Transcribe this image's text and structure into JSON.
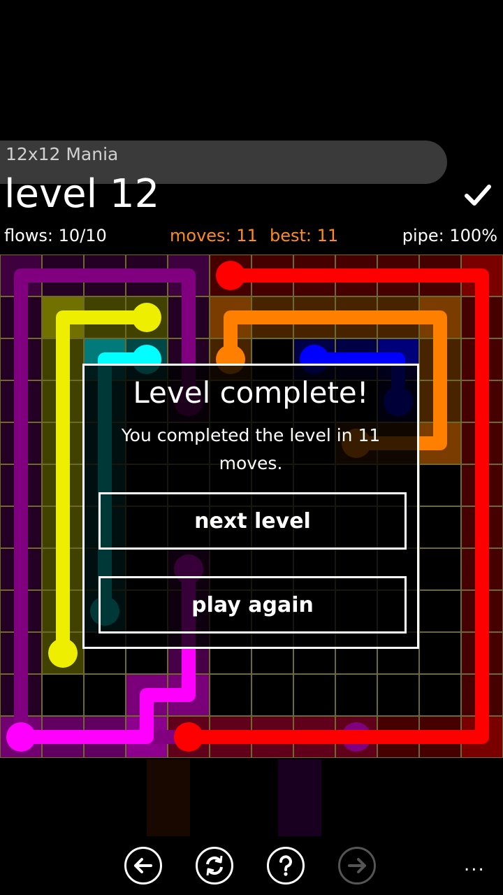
{
  "header": {
    "pack_name": "12x12 Mania",
    "level_title": "level 12",
    "check_icon": "checkmark-icon"
  },
  "stats": {
    "flows": "flows: 10/10",
    "moves": "moves: 11",
    "best": "best: 11",
    "pipe": "pipe: 100%"
  },
  "colors": {
    "background": "#000000",
    "board_line": "#6e6a2a",
    "accent_orange": "#ff8c1a",
    "red": "#ff0000",
    "orange": "#ff7f00",
    "yellow": "#eeee00",
    "cyan": "#00ffff",
    "blue": "#0000ff",
    "purple": "#800080",
    "magenta": "#ff00ff",
    "green": "#008000",
    "gray": "#a0a0a0",
    "maroon": "#a52a2a"
  },
  "board": {
    "size": 12,
    "flows": [
      {
        "color": "#800080",
        "path": [
          [
            8,
            11
          ],
          [
            0,
            11
          ],
          [
            0,
            0
          ],
          [
            4,
            0
          ],
          [
            4,
            3
          ]
        ]
      },
      {
        "color": "#eeee00",
        "path": [
          [
            3,
            1
          ],
          [
            1,
            1
          ],
          [
            1,
            9
          ]
        ]
      },
      {
        "color": "#ff00ff",
        "path": [
          [
            0,
            11
          ],
          [
            3,
            11
          ],
          [
            3,
            10
          ],
          [
            4,
            10
          ],
          [
            4,
            7
          ]
        ]
      },
      {
        "color": "#ff0000",
        "path": [
          [
            5,
            0
          ],
          [
            11,
            0
          ],
          [
            11,
            11
          ],
          [
            4,
            11
          ]
        ]
      },
      {
        "color": "#ff7f00",
        "path": [
          [
            5,
            2
          ],
          [
            5,
            1
          ],
          [
            10,
            1
          ],
          [
            10,
            4
          ],
          [
            8,
            4
          ]
        ]
      },
      {
        "color": "#0000ff",
        "path": [
          [
            7,
            2
          ],
          [
            9,
            2
          ],
          [
            9,
            3
          ]
        ]
      },
      {
        "color": "#00ffff",
        "path": [
          [
            3,
            2
          ],
          [
            2,
            2
          ],
          [
            2,
            8
          ]
        ]
      }
    ],
    "hidden_flow_colors": [
      "#a0a0a0",
      "#800080",
      "#008000",
      "#a52a2a"
    ]
  },
  "dialog": {
    "title": "Level complete!",
    "message": "You completed the level in 11 moves.",
    "next_label": "next level",
    "again_label": "play again"
  },
  "appbar": {
    "buttons": [
      {
        "icon": "back-arrow-icon",
        "enabled": true
      },
      {
        "icon": "refresh-icon",
        "enabled": true
      },
      {
        "icon": "help-icon",
        "enabled": true
      },
      {
        "icon": "forward-arrow-icon",
        "enabled": false
      }
    ],
    "more": "..."
  }
}
